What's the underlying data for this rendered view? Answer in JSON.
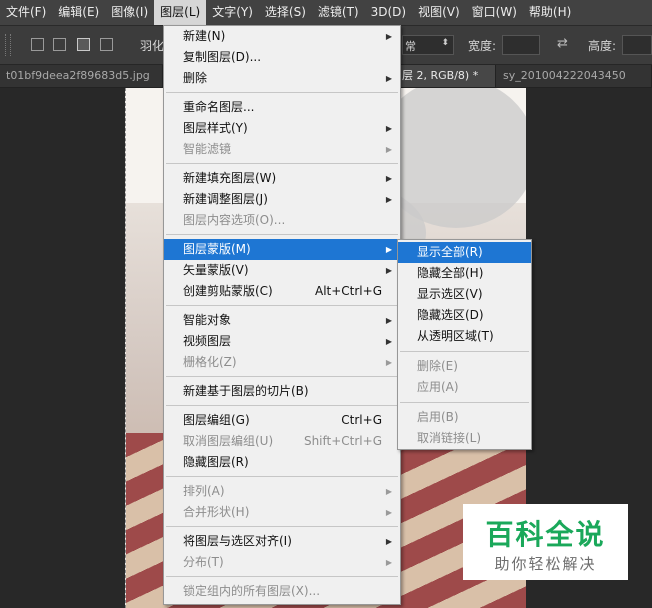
{
  "menubar": [
    {
      "label": "文件(F)"
    },
    {
      "label": "编辑(E)"
    },
    {
      "label": "图像(I)"
    },
    {
      "label": "图层(L)",
      "active": true
    },
    {
      "label": "文字(Y)"
    },
    {
      "label": "选择(S)"
    },
    {
      "label": "滤镜(T)"
    },
    {
      "label": "3D(D)"
    },
    {
      "label": "视图(V)"
    },
    {
      "label": "窗口(W)"
    },
    {
      "label": "帮助(H)"
    }
  ],
  "options_bar": {
    "feather_label": "羽化",
    "style_partial": "常",
    "width_label": "宽度:",
    "height_label": "高度:"
  },
  "tabs": [
    {
      "label": "t01bf9deea2f89683d5.jpg",
      "active": false
    },
    {
      "label": "层 2, RGB/8) *",
      "active": true
    },
    {
      "label": "sy_201004222043450",
      "active": false
    }
  ],
  "layer_menu": [
    {
      "label": "新建(N)",
      "arrow": true
    },
    {
      "label": "复制图层(D)..."
    },
    {
      "label": "删除",
      "arrow": true
    },
    {
      "sep": true
    },
    {
      "label": "重命名图层..."
    },
    {
      "label": "图层样式(Y)",
      "arrow": true
    },
    {
      "label": "智能滤镜",
      "arrow": true,
      "disabled": true
    },
    {
      "sep": true
    },
    {
      "label": "新建填充图层(W)",
      "arrow": true
    },
    {
      "label": "新建调整图层(J)",
      "arrow": true
    },
    {
      "label": "图层内容选项(O)...",
      "disabled": true
    },
    {
      "sep": true
    },
    {
      "label": "图层蒙版(M)",
      "arrow": true,
      "highlighted": true
    },
    {
      "label": "矢量蒙版(V)",
      "arrow": true
    },
    {
      "label": "创建剪贴蒙版(C)",
      "shortcut": "Alt+Ctrl+G"
    },
    {
      "sep": true
    },
    {
      "label": "智能对象",
      "arrow": true
    },
    {
      "label": "视频图层",
      "arrow": true
    },
    {
      "label": "栅格化(Z)",
      "arrow": true,
      "disabled": true
    },
    {
      "sep": true
    },
    {
      "label": "新建基于图层的切片(B)"
    },
    {
      "sep": true
    },
    {
      "label": "图层编组(G)",
      "shortcut": "Ctrl+G"
    },
    {
      "label": "取消图层编组(U)",
      "shortcut": "Shift+Ctrl+G",
      "disabled": true
    },
    {
      "label": "隐藏图层(R)"
    },
    {
      "sep": true
    },
    {
      "label": "排列(A)",
      "arrow": true,
      "disabled": true
    },
    {
      "label": "合并形状(H)",
      "arrow": true,
      "disabled": true
    },
    {
      "sep": true
    },
    {
      "label": "将图层与选区对齐(I)",
      "arrow": true
    },
    {
      "label": "分布(T)",
      "arrow": true,
      "disabled": true
    },
    {
      "sep": true
    },
    {
      "label": "锁定组内的所有图层(X)...",
      "disabled": true
    }
  ],
  "mask_submenu": [
    {
      "label": "显示全部(R)",
      "highlighted": true
    },
    {
      "label": "隐藏全部(H)"
    },
    {
      "label": "显示选区(V)"
    },
    {
      "label": "隐藏选区(D)"
    },
    {
      "label": "从透明区域(T)"
    },
    {
      "sep": true
    },
    {
      "label": "删除(E)",
      "disabled": true
    },
    {
      "label": "应用(A)",
      "disabled": true
    },
    {
      "sep": true
    },
    {
      "label": "启用(B)",
      "disabled": true
    },
    {
      "label": "取消链接(L)",
      "disabled": true
    }
  ],
  "watermark": {
    "title": "百科全说",
    "subtitle": "助你轻松解决"
  }
}
